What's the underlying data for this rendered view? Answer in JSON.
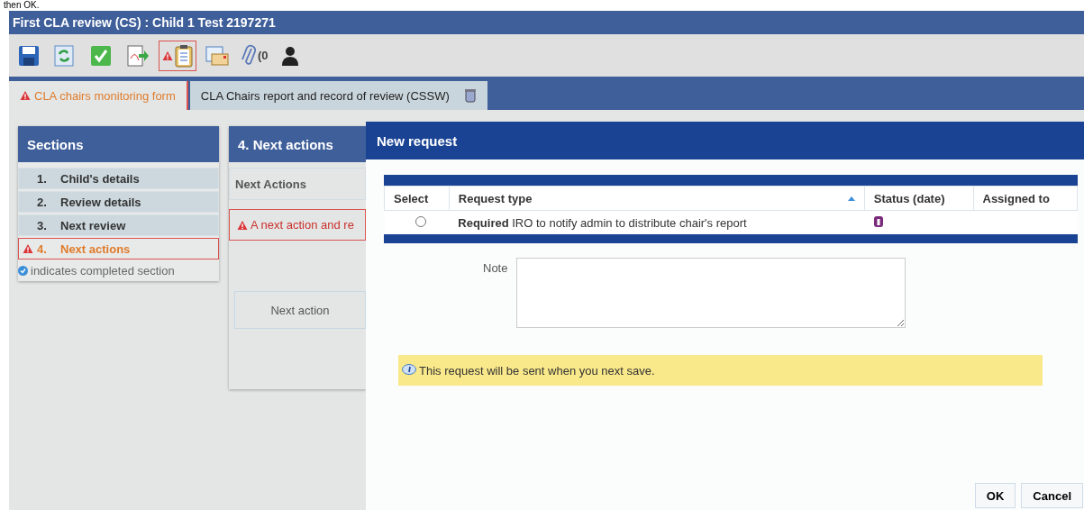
{
  "instruction_fragment": "then OK.",
  "window": {
    "title": "First CLA review (CS) :  Child 1 Test  2197271"
  },
  "toolbar": {
    "buttons": [
      {
        "kind": "save",
        "selected": false
      },
      {
        "kind": "refresh",
        "selected": false
      },
      {
        "kind": "complete",
        "selected": false
      },
      {
        "kind": "export",
        "selected": false
      },
      {
        "kind": "warnings",
        "selected": true
      },
      {
        "kind": "letter",
        "selected": false
      },
      {
        "kind": "attach",
        "selected": false,
        "count": "(0"
      },
      {
        "kind": "person",
        "selected": false
      }
    ]
  },
  "tabs": [
    {
      "label": "CLA chairs monitoring form",
      "selected": true,
      "warning": true
    },
    {
      "label": "CLA Chairs report and record of review (CSSW)",
      "selected": false,
      "warning": false
    }
  ],
  "sections": {
    "title": "Sections",
    "items": [
      {
        "number": "1.",
        "label": "Child's details",
        "selected": false,
        "warning": false
      },
      {
        "number": "2.",
        "label": "Review details",
        "selected": false,
        "warning": false
      },
      {
        "number": "3.",
        "label": "Next review",
        "selected": false,
        "warning": false
      },
      {
        "number": "4.",
        "label": "Next actions",
        "selected": true,
        "warning": true
      }
    ],
    "legend": "indicates completed section"
  },
  "panel": {
    "title": "4. Next actions",
    "subtitle": "Next Actions",
    "error": "A next action and re",
    "button": "Next action"
  },
  "dialog": {
    "title": "New request",
    "columns": [
      "Select",
      "Request type",
      "Status (date)",
      "Assigned to"
    ],
    "rows": [
      {
        "selected": false,
        "request_type": "**Required** IRO to notify admin to distribute chair's report"
      }
    ],
    "note_label": "Note",
    "info": "This request will be sent when you next save.",
    "buttons": [
      "OK",
      "Cancel"
    ]
  }
}
